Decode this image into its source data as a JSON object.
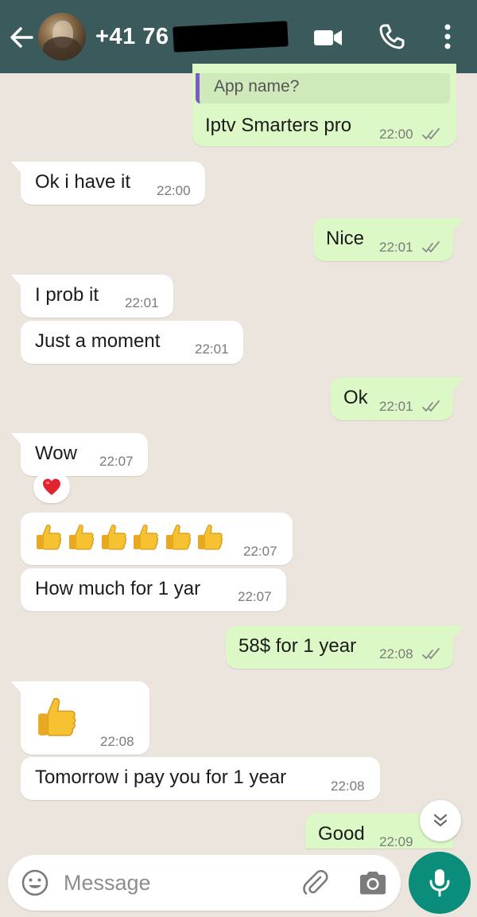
{
  "header": {
    "contact": "+41 76 ",
    "icons": [
      "back-arrow-icon",
      "avatar",
      "video-call-icon",
      "phone-icon",
      "more-vert-icon"
    ]
  },
  "colors": {
    "header_bg": "#3b5a5b",
    "chat_bg": "#ece5dd",
    "incoming_bubble": "#ffffff",
    "outgoing_bubble": "#dcf8c6",
    "accent": "#0a8d7b",
    "reply_bar": "#7b5cc6"
  },
  "messages": [
    {
      "dir": "out",
      "quote": "App name?",
      "text": "Iptv Smarters pro",
      "time": "22:00"
    },
    {
      "dir": "in",
      "text": "Ok i have it",
      "time": "22:00"
    },
    {
      "dir": "out",
      "text": "Nice",
      "time": "22:01"
    },
    {
      "dir": "in",
      "text": "I prob it",
      "time": "22:01"
    },
    {
      "dir": "in",
      "text": "Just a moment",
      "time": "22:01"
    },
    {
      "dir": "out",
      "text": "Ok",
      "time": "22:01"
    },
    {
      "dir": "in",
      "text": "Wow",
      "time": "22:07",
      "reaction": "heart-emoji"
    },
    {
      "dir": "in",
      "text": "👍👍👍👍👍👍",
      "time": "22:07"
    },
    {
      "dir": "in",
      "text": "How much for 1 yar",
      "time": "22:07"
    },
    {
      "dir": "out",
      "text": "58$ for 1 year",
      "time": "22:08"
    },
    {
      "dir": "in",
      "text": "👍",
      "time": "22:08"
    },
    {
      "dir": "in",
      "text": "Tomorrow i pay you for 1 year",
      "time": "22:08"
    },
    {
      "dir": "out",
      "text": "Good",
      "time": "22:09"
    }
  ],
  "input": {
    "placeholder": "Message"
  }
}
